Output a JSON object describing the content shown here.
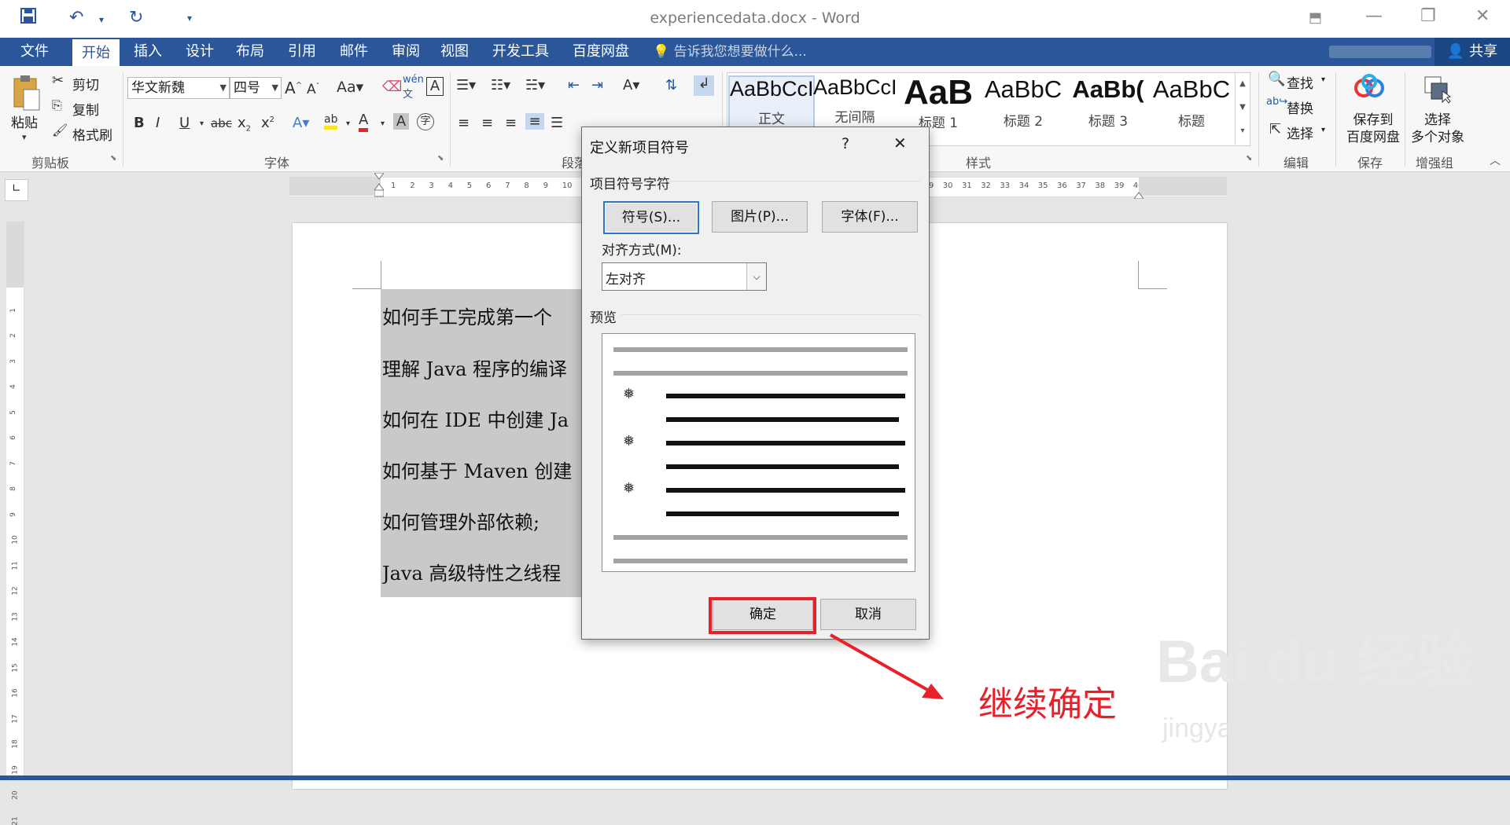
{
  "window": {
    "title": "experiencedata.docx - Word"
  },
  "tabs": {
    "file": "文件",
    "items": [
      "开始",
      "插入",
      "设计",
      "布局",
      "引用",
      "邮件",
      "审阅",
      "视图",
      "开发工具",
      "百度网盘"
    ],
    "tell_me": "告诉我您想要做什么...",
    "share": "共享"
  },
  "ribbon": {
    "clipboard": {
      "paste": "粘贴",
      "cut": "剪切",
      "copy": "复制",
      "format_painter": "格式刷",
      "label": "剪贴板"
    },
    "font": {
      "font_name": "华文新魏",
      "font_size": "四号",
      "label": "字体",
      "change_case": "Aa"
    },
    "paragraph": {
      "label": "段落"
    },
    "styles": {
      "label": "样式",
      "items": [
        {
          "sample": "AaBbCcI",
          "name": "正文"
        },
        {
          "sample": "AaBbCcI",
          "name": "无间隔"
        },
        {
          "sample": "AaB",
          "name": "标题 1"
        },
        {
          "sample": "AaBbC",
          "name": "标题 2"
        },
        {
          "sample": "AaBb(",
          "name": "标题 3"
        },
        {
          "sample": "AaBbC",
          "name": "标题"
        }
      ]
    },
    "editing": {
      "find": "查找",
      "replace": "替换",
      "select": "选择",
      "label": "编辑"
    },
    "save": {
      "line1": "保存到",
      "line2": "百度网盘",
      "label": "保存"
    },
    "enhance": {
      "line1": "选择",
      "line2": "多个对象",
      "label": "增强组"
    }
  },
  "document": {
    "lines": [
      "如何手工完成第一个",
      "理解 Java 程序的编译",
      "如何在 IDE 中创建 Ja",
      "如何基于 Maven 创建",
      "如何管理外部依赖;",
      "Java 高级特性之线程"
    ]
  },
  "dialog": {
    "title": "定义新项目符号",
    "help": "?",
    "close": "✕",
    "section_bullet": "项目符号字符",
    "symbol_button": "符号(S)...",
    "picture_button": "图片(P)...",
    "font_button": "字体(F)...",
    "alignment_label": "对齐方式(M):",
    "alignment_value": "左对齐",
    "preview_label": "预览",
    "bullet_glyph": "❅",
    "ok": "确定",
    "cancel": "取消"
  },
  "annotation": {
    "text": "继续确定"
  },
  "watermark": {
    "brand": "Bai du 经验",
    "url": "jingyan.baidu.com"
  },
  "colors": {
    "accent": "#2b579a",
    "annotation": "#e8202a"
  }
}
